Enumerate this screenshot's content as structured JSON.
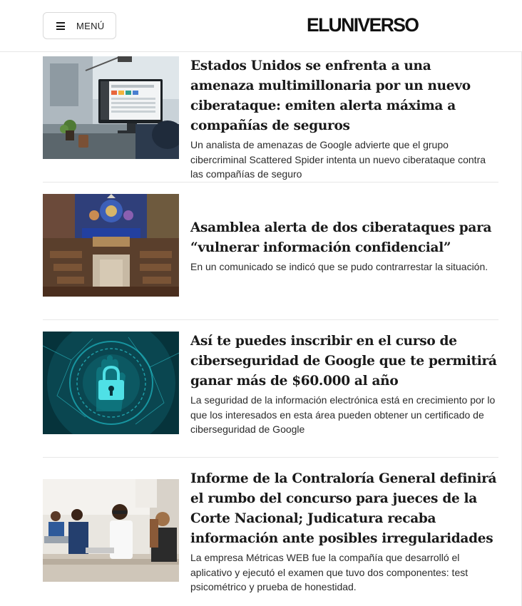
{
  "header": {
    "menu_label": "MENÚ",
    "logo_text": "ELUNIVERSO"
  },
  "articles": [
    {
      "headline": "Estados Unidos se enfrenta a una amenaza multimillonaria por un nuevo ciberataque: emiten alerta máxima a compañías de seguros",
      "summary": "Un analista de amenazas de Google advierte que el grupo cibercriminal Scattered Spider intenta un nuevo ciberataque contra las compañías de seguro",
      "image": "office-computer-dashboard"
    },
    {
      "headline": "Asamblea alerta de dos ciberataques para “vulnerar información confidencial”",
      "summary": "En un comunicado se indicó que se pudo contrarrestar la situación.",
      "image": "assembly-chamber"
    },
    {
      "headline": "Así te puedes inscribir en el curso de ciberseguridad de Google que te permitirá ganar más de $60.000 al año",
      "summary": "La seguridad de la información electrónica está en crecimiento por lo que los interesados en esta área pueden obtener un certificado de ciberseguridad de Google",
      "image": "cyber-security-lock"
    },
    {
      "headline": "Informe de la Contraloría General definirá el rumbo del concurso para jueces de la Corte Nacional; Judicatura recaba información ante posibles irregularidades",
      "summary": "La empresa Métricas WEB fue la compañía que desarrolló el aplicativo y ejecutó el examen que tuvo dos componentes: test psicométrico y prueba de honestidad.",
      "image": "people-taking-exam"
    }
  ],
  "colors": {
    "divider": "#e8e8e8",
    "text": "#1a1a1a",
    "cyber_teal": "#0d8f9a"
  }
}
